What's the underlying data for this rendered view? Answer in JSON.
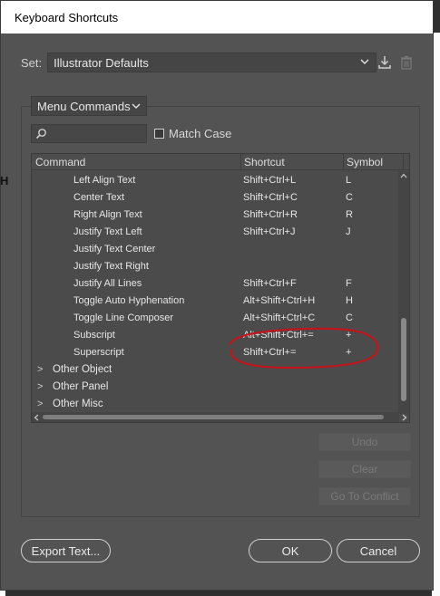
{
  "window": {
    "title": "Keyboard Shortcuts"
  },
  "background": {
    "fragment": "H"
  },
  "set": {
    "label": "Set:",
    "value": "Illustrator Defaults",
    "save_icon": "save-set-icon",
    "delete_icon": "delete-set-icon"
  },
  "category": {
    "value": "Menu Commands"
  },
  "search": {
    "value": "",
    "placeholder": ""
  },
  "match_case": {
    "label": "Match Case",
    "checked": false
  },
  "table": {
    "headers": {
      "command": "Command",
      "shortcut": "Shortcut",
      "symbol": "Symbol"
    },
    "rows": [
      {
        "command": "Left Align Text",
        "shortcut": "Shift+Ctrl+L",
        "symbol": "L"
      },
      {
        "command": "Center Text",
        "shortcut": "Shift+Ctrl+C",
        "symbol": "C"
      },
      {
        "command": "Right Align Text",
        "shortcut": "Shift+Ctrl+R",
        "symbol": "R"
      },
      {
        "command": "Justify Text Left",
        "shortcut": "Shift+Ctrl+J",
        "symbol": "J"
      },
      {
        "command": "Justify Text Center",
        "shortcut": "",
        "symbol": ""
      },
      {
        "command": "Justify Text Right",
        "shortcut": "",
        "symbol": ""
      },
      {
        "command": "Justify All Lines",
        "shortcut": "Shift+Ctrl+F",
        "symbol": "F"
      },
      {
        "command": "Toggle Auto Hyphenation",
        "shortcut": "Alt+Shift+Ctrl+H",
        "symbol": "H"
      },
      {
        "command": "Toggle Line Composer",
        "shortcut": "Alt+Shift+Ctrl+C",
        "symbol": "C"
      },
      {
        "command": "Subscript",
        "shortcut": "Alt+Shift+Ctrl+=",
        "symbol": "+"
      },
      {
        "command": "Superscript",
        "shortcut": "Shift+Ctrl+=",
        "symbol": "+"
      }
    ],
    "groups": [
      {
        "label": "Other Object",
        "expander": ">"
      },
      {
        "label": "Other Panel",
        "expander": ">"
      },
      {
        "label": "Other Misc",
        "expander": ">"
      }
    ]
  },
  "side_buttons": {
    "undo": "Undo",
    "clear": "Clear",
    "go_to_conflict": "Go To Conflict"
  },
  "footer": {
    "export": "Export Text...",
    "ok": "OK",
    "cancel": "Cancel"
  },
  "colors": {
    "dialog_bg": "#535353",
    "annotation": "#c0151b",
    "disabled_text": "#7a7a7a"
  }
}
